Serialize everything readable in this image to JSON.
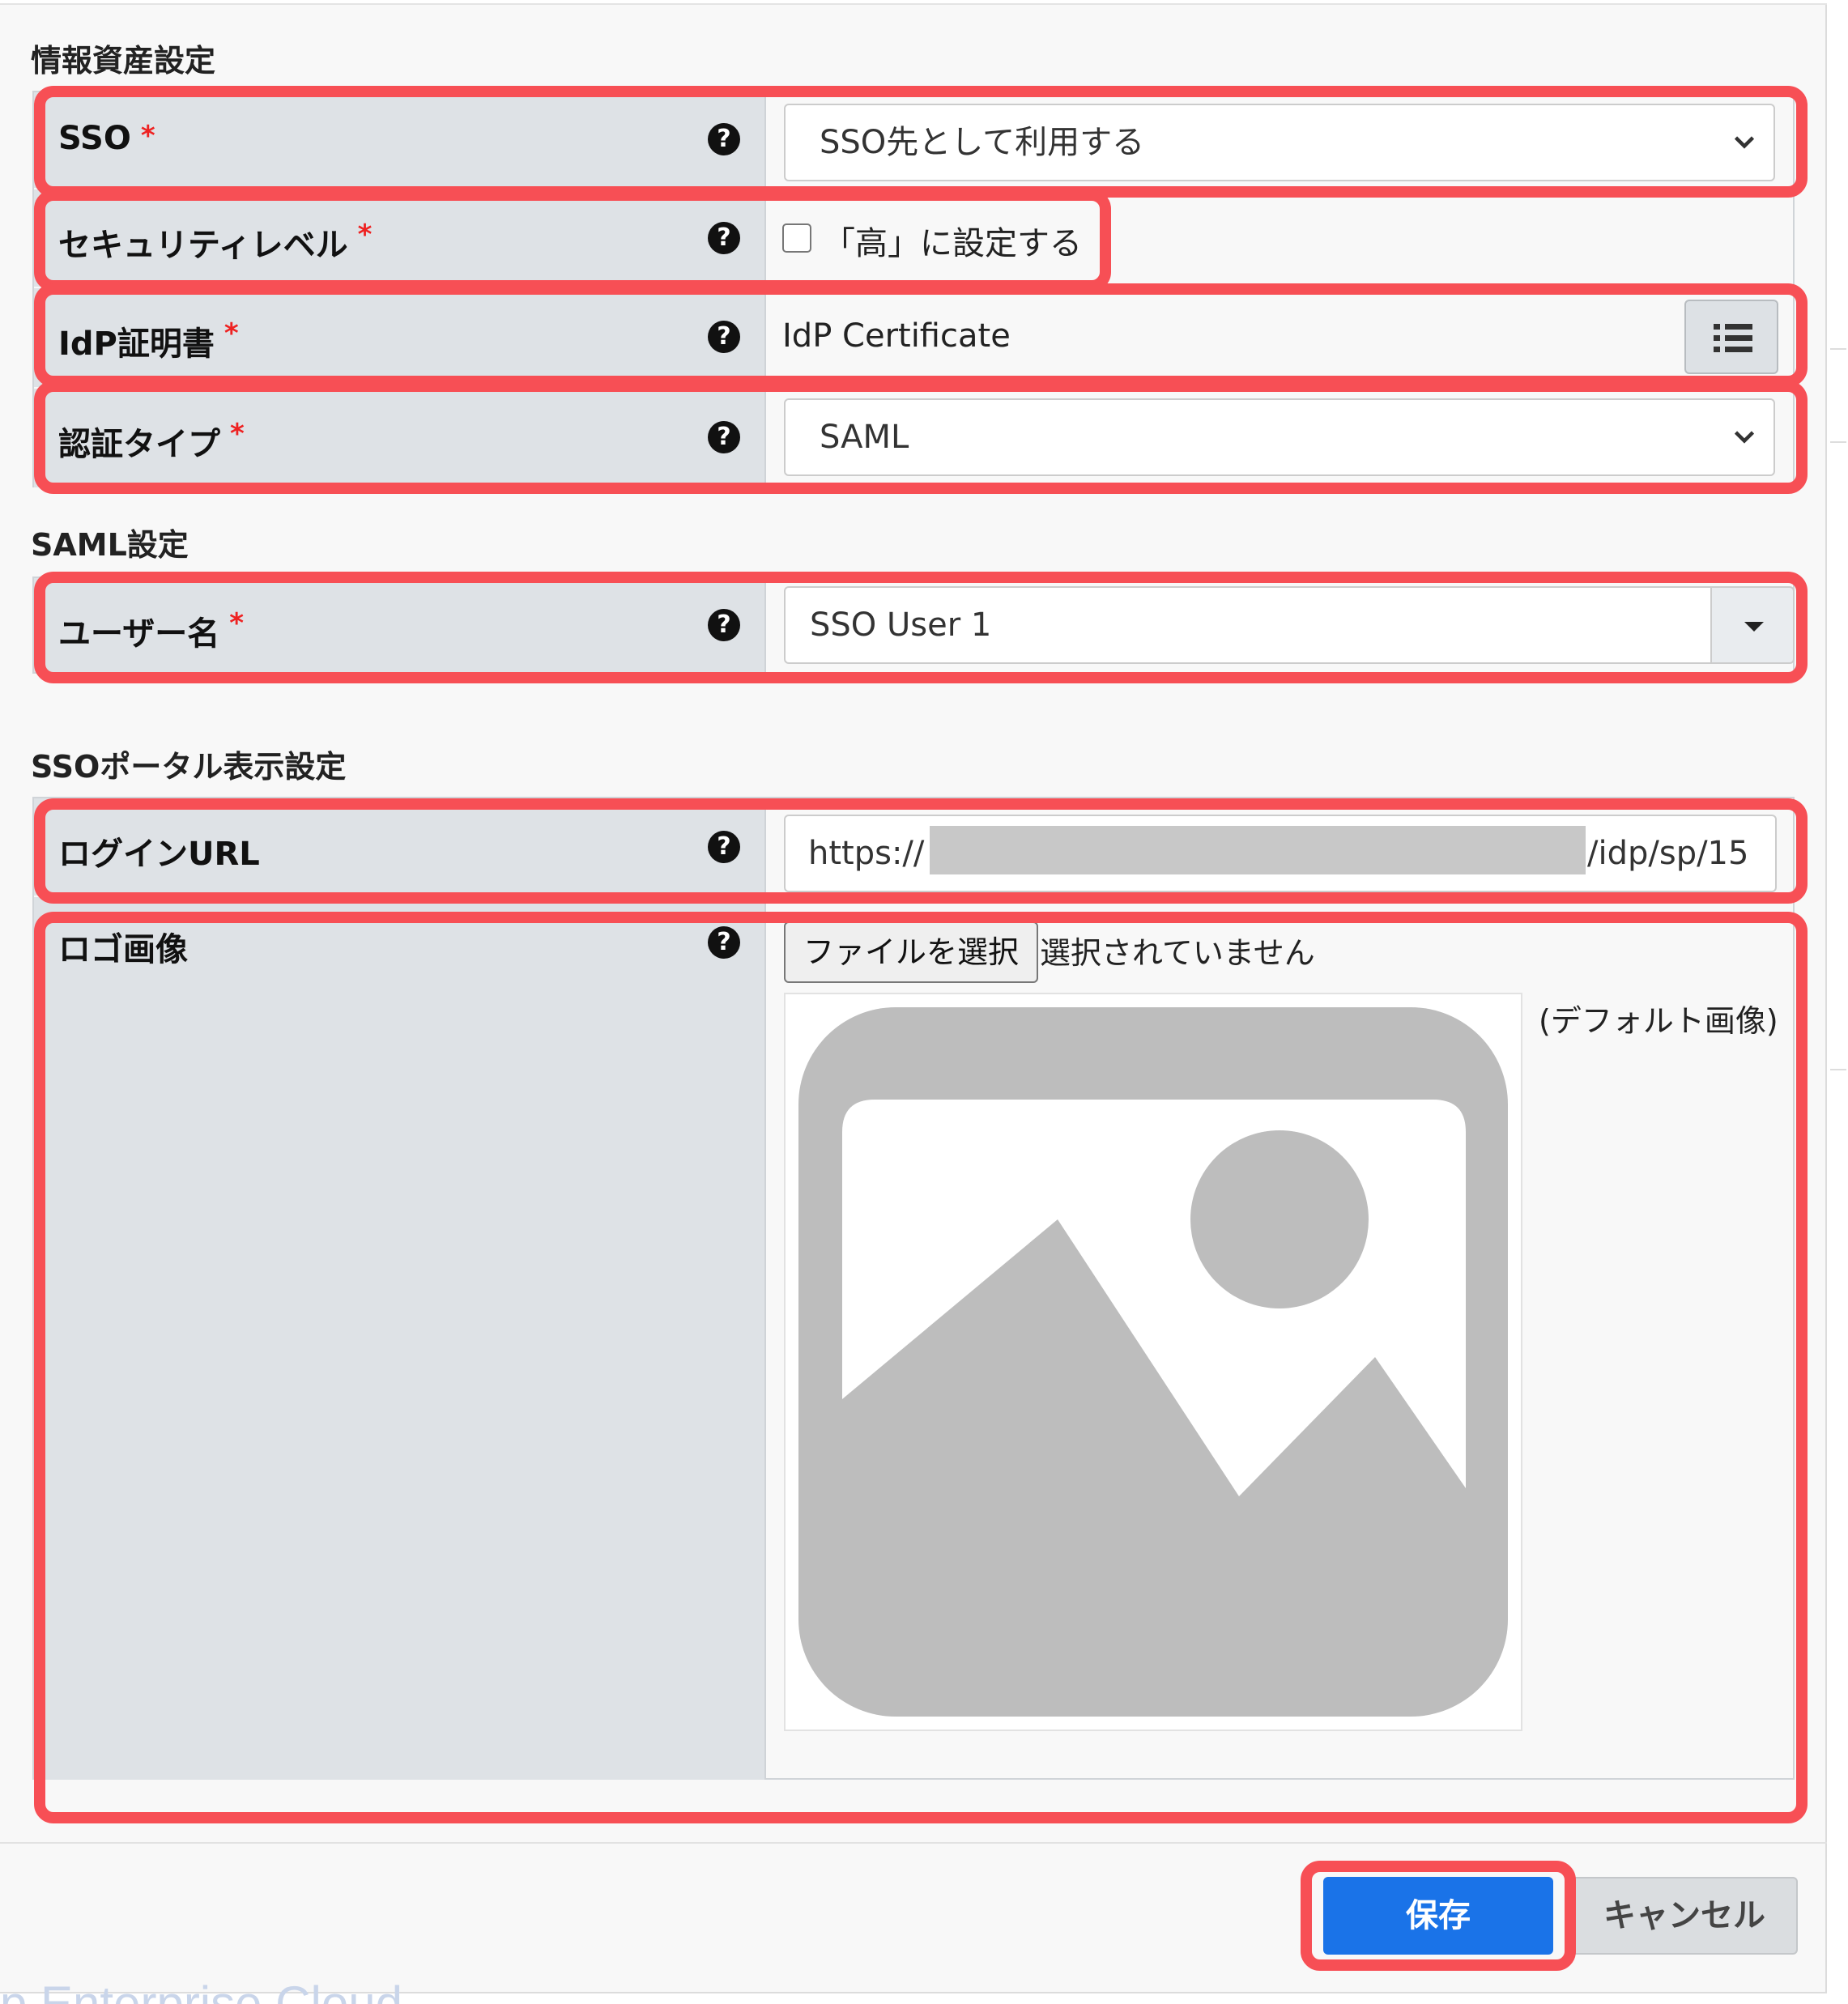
{
  "sections": {
    "asset": "情報資産設定",
    "saml": "SAML設定",
    "portal": "SSOポータル表示設定"
  },
  "required_mark": "*",
  "help_glyph": "?",
  "fields": {
    "sso": {
      "label": "SSO",
      "value": "SSO先として利用する"
    },
    "security": {
      "label": "セキュリティレベル",
      "checkbox_label": "「高」に設定する",
      "checked": false
    },
    "idp_cert": {
      "label": "IdP証明書",
      "value": "IdP Certificate"
    },
    "auth_type": {
      "label": "認証タイプ",
      "value": "SAML"
    },
    "username": {
      "label": "ユーザー名",
      "value": "SSO User 1"
    },
    "login_url": {
      "label": "ログインURL",
      "prefix": "https://",
      "suffix": "/idp/sp/15"
    },
    "logo": {
      "label": "ロゴ画像",
      "file_button": "ファイルを選択",
      "file_status": "選択されていません",
      "default_note": "(デフォルト画像)"
    }
  },
  "footer": {
    "save": "保存",
    "cancel": "キャンセル"
  },
  "background_text": "p Enterprise Cloud",
  "colors": {
    "highlight": "#f74f55",
    "primary": "#1a73e8",
    "label_bg": "#dee2e6",
    "placeholder_gray": "#bdbdbd"
  }
}
